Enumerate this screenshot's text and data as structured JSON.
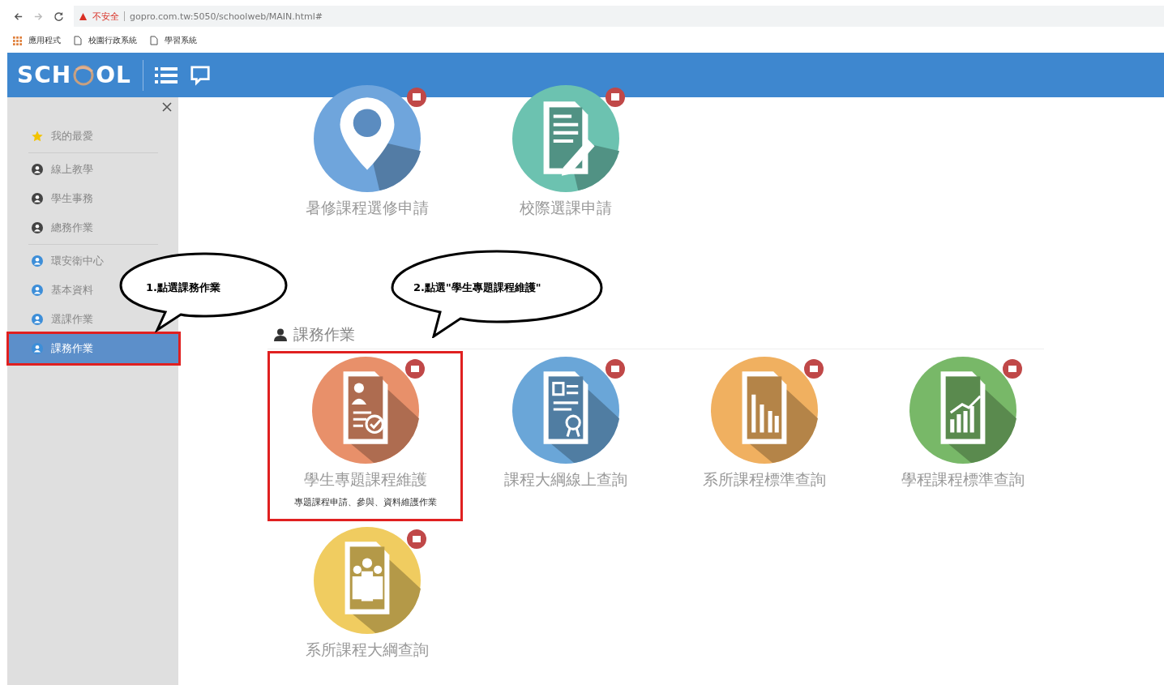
{
  "browser": {
    "security": "不安全",
    "url": "gopro.com.tw:5050/schoolweb/MAIN.html#",
    "bookmarks": [
      "應用程式",
      "校園行政系統",
      "學習系統"
    ]
  },
  "header": {
    "logo_left": "SCH",
    "logo_right": "OL"
  },
  "sidebar": {
    "groups": [
      {
        "items": [
          {
            "label": "我的最愛",
            "kind": "star",
            "color": "#f2c300",
            "selected": false,
            "annotated": false
          }
        ]
      },
      {
        "items": [
          {
            "label": "線上教學",
            "kind": "user",
            "color": "#444444",
            "selected": false,
            "annotated": false
          },
          {
            "label": "學生事務",
            "kind": "user",
            "color": "#444444",
            "selected": false,
            "annotated": false
          },
          {
            "label": "總務作業",
            "kind": "user",
            "color": "#444444",
            "selected": false,
            "annotated": false
          }
        ]
      },
      {
        "items": [
          {
            "label": "環安衛中心",
            "kind": "user",
            "color": "#3d8ed8",
            "selected": false,
            "annotated": false
          },
          {
            "label": "基本資料",
            "kind": "user",
            "color": "#3d8ed8",
            "selected": false,
            "annotated": false
          },
          {
            "label": "選課作業",
            "kind": "user",
            "color": "#3d8ed8",
            "selected": false,
            "annotated": false
          },
          {
            "label": "課務作業",
            "kind": "user",
            "color": "#3d8ed8",
            "selected": true,
            "annotated": true
          }
        ]
      }
    ]
  },
  "top_tiles": [
    {
      "label": "暑修課程選修申請",
      "kind": "pin",
      "color": "#6fa5dc",
      "annotated": false
    },
    {
      "label": "校際選課申請",
      "kind": "doc-pen",
      "color": "#6cc2b0",
      "annotated": false
    }
  ],
  "section": {
    "title": "課務作業",
    "tiles": [
      {
        "label": "學生專題課程維護",
        "description": "專題課程申請、參與、資料維護作業",
        "kind": "doc-person",
        "color": "#e8906a",
        "annotated": true
      },
      {
        "label": "課程大綱線上查詢",
        "kind": "doc-cert",
        "color": "#6aa6d8",
        "annotated": false
      },
      {
        "label": "系所課程標準查詢",
        "kind": "doc-bars",
        "color": "#f0b060",
        "annotated": false
      },
      {
        "label": "學程課程標準查詢",
        "kind": "doc-chart",
        "color": "#78b868",
        "annotated": false
      },
      {
        "label": "系所課程大綱查詢",
        "kind": "doc-people",
        "color": "#f0cc60",
        "annotated": false
      }
    ]
  },
  "callouts": [
    "1.點選課務作業",
    "2.點選\"學生專題課程維護\""
  ]
}
